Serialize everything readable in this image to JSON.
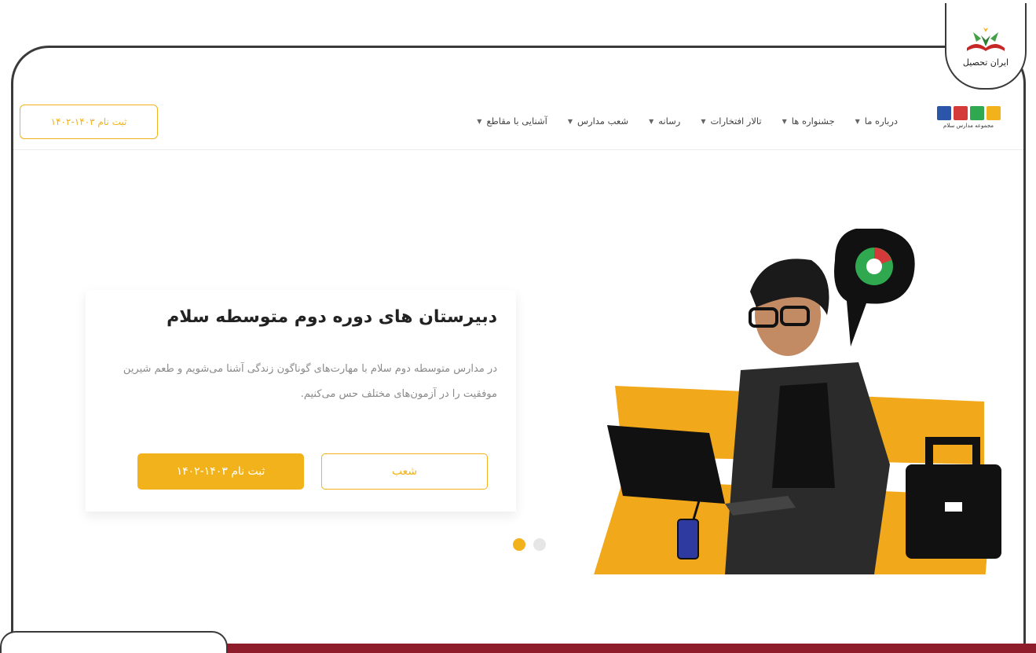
{
  "badge": {
    "text": "ایران تحصیل"
  },
  "nav": {
    "register_button": "ثبت نام ۱۴۰۳-۱۴۰۲",
    "menu": [
      {
        "label": "آشنایی با مقاطع"
      },
      {
        "label": "شعب مدارس"
      },
      {
        "label": "رسانه"
      },
      {
        "label": "تالار افتخارات"
      },
      {
        "label": "جشنواره ها"
      },
      {
        "label": "درباره ما"
      }
    ],
    "brand_sub": "مجموعه مدارس سلام"
  },
  "hero": {
    "title": "دبیرستان های دوره دوم متوسطه سلام",
    "description": "در مدارس متوسطه دوم سلام با مهارت‌های گوناگون زندگی آشنا می‌شویم و طعم شیرین موفقیت را در آزمون‌های مختلف حس می‌کنیم.",
    "primary_button": "ثبت نام ۱۴۰۳-۱۴۰۲",
    "secondary_button": "شعب"
  },
  "colors": {
    "accent": "#f2b21b",
    "maroon": "#8f1c2a"
  },
  "slider": {
    "slides": 2,
    "active": 1
  }
}
